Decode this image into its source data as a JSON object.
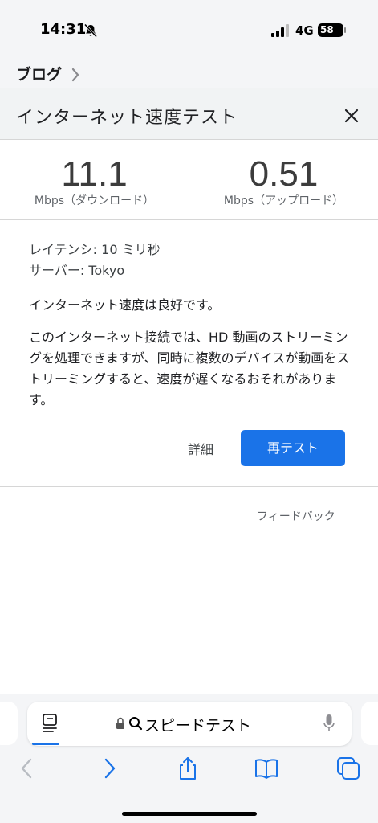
{
  "status": {
    "time": "14:31",
    "network": "4G",
    "battery": "58",
    "icons": [
      "bell-slash-icon",
      "cellular-signal-icon"
    ]
  },
  "breadcrumb": {
    "label": "ブログ",
    "icon": "chevron-right-icon"
  },
  "header": {
    "title": "インターネット速度テスト",
    "close_icon": "close-icon"
  },
  "results": {
    "download": {
      "value": "11.1",
      "label": "Mbps（ダウンロード）"
    },
    "upload": {
      "value": "0.51",
      "label": "Mbps（アップロード）"
    }
  },
  "info": {
    "latency": "レイテンシ: 10 ミリ秒",
    "server": "サーバー: Tokyo",
    "summary": "インターネット速度は良好です。",
    "detail": "このインターネット接続では、HD 動画のストリーミングを処理できますが、同時に複数のデバイスが動画をストリーミングすると、速度が遅くなるおそれがあります。"
  },
  "actions": {
    "details_label": "詳細",
    "retest_label": "再テスト"
  },
  "feedback_label": "フィードバック",
  "browser": {
    "address_text": "スピードテスト",
    "icons": [
      "reader-icon",
      "lock-icon",
      "search-icon",
      "microphone-icon",
      "back-icon",
      "forward-icon",
      "share-icon",
      "bookmarks-icon",
      "tabs-icon"
    ]
  },
  "colors": {
    "accent": "#1a73e8",
    "nav_active": "#1a73e8",
    "nav_disabled": "#b8bcc2"
  }
}
